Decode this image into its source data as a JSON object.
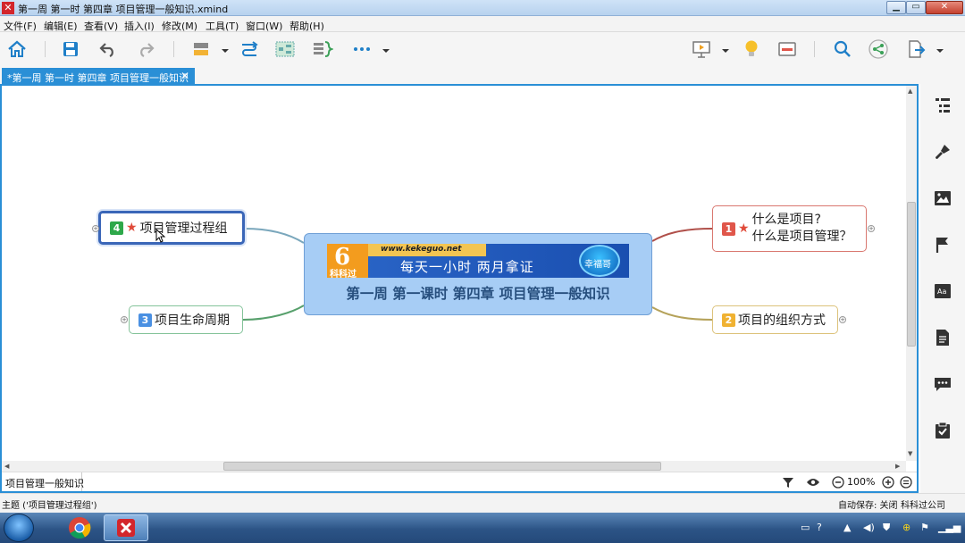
{
  "window": {
    "title": "第一周  第一时 第四章 项目管理一般知识.xmind",
    "app_icon": "xmind-icon",
    "controls": [
      "minimize",
      "maximize",
      "close"
    ]
  },
  "menu": [
    "文件(F)",
    "编辑(E)",
    "查看(V)",
    "插入(I)",
    "修改(M)",
    "工具(T)",
    "窗口(W)",
    "帮助(H)"
  ],
  "toolbar": {
    "left_icons": [
      "home-icon",
      "save-icon",
      "undo-icon",
      "redo-icon",
      "topic-icon",
      "relationship-icon",
      "boundary-icon",
      "summary-icon",
      "more-icon"
    ],
    "right_icons": [
      "presentation-icon",
      "idea-icon",
      "layout-icon",
      "search-icon",
      "share-icon",
      "export-icon"
    ]
  },
  "tab": {
    "label": "*第一周  第一时 第四章 项目管理一般知识",
    "close": "✕"
  },
  "mindmap": {
    "central": {
      "banner_url": "www.kekeguo.net",
      "banner_logo_text": "科科过",
      "banner_slogan": "每天一小时    两月拿证",
      "banner_badge": "幸福哥",
      "title": "第一周 第一课时 第四章 项目管理一般知识"
    },
    "topics": [
      {
        "priority": "1",
        "star": true,
        "line1": "什么是项目?",
        "line2": "什么是项目管理？",
        "color": "#e0564a"
      },
      {
        "priority": "2",
        "star": false,
        "label": "项目的组织方式",
        "color": "#f0b232"
      },
      {
        "priority": "3",
        "star": false,
        "label": "项目生命周期",
        "color": "#4a90e2"
      },
      {
        "priority": "4",
        "star": true,
        "label": "项目管理过程组",
        "color": "#2ea84a",
        "selected": true
      }
    ],
    "expand_symbol": "+"
  },
  "editor_status": {
    "sheet_name": "项目管理一般知识",
    "zoom": "100%",
    "icons": [
      "filter-icon",
      "eye-icon",
      "zoom-out-icon",
      "zoom-in-icon",
      "zoom-fit-icon"
    ]
  },
  "right_panel": [
    "outline-icon",
    "format-icon",
    "image-icon",
    "marker-icon",
    "text-icon",
    "notes-icon",
    "comments-icon",
    "task-icon"
  ],
  "status": {
    "left": "主题 ('项目管理过程组')",
    "autosave": "自动保存: 关闭",
    "company": "科科过公司"
  },
  "taskbar": {
    "apps": [
      "chrome-icon",
      "xmind-icon"
    ],
    "tray": [
      "network-icon",
      "help-icon",
      "volume-icon",
      "shield-icon",
      "signal-icon"
    ]
  },
  "colors": {
    "accent": "#2a8fd6",
    "central_fill": "#a7cdf5",
    "central_text": "#274f7e"
  }
}
